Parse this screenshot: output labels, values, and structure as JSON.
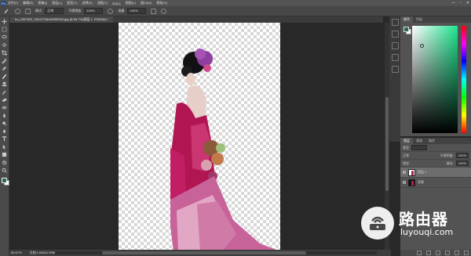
{
  "menubar": {
    "logo": "Ps",
    "items": [
      "文件(F)",
      "编辑(E)",
      "图像(I)",
      "图层(L)",
      "类型(Y)",
      "选择(S)",
      "滤镜(T)",
      "3D(D)",
      "视图(V)",
      "窗口(W)",
      "帮助(H)"
    ],
    "window_controls": [
      "—",
      "▫",
      "✕"
    ]
  },
  "options": {
    "mode_label": "模式:",
    "mode_value": "正常",
    "opacity_label": "不透明度:",
    "opacity_value": "100%",
    "flow_label": "流量:",
    "flow_value": "100%"
  },
  "document": {
    "tab_title": "hu_1557823_26122736c60f0f5062.jpg @ 66.7%(图层 1, RGB/8#) *"
  },
  "status": {
    "zoom": "66.67%",
    "doc_info": "文档:1.65M/1.99M"
  },
  "color_panel": {
    "tabs": [
      "颜色",
      "色板"
    ],
    "fg_color": "#2a6d4c",
    "bg_color": "#ffffff",
    "hue_color": "#1ee58f"
  },
  "layers_panel": {
    "tabs": [
      "图层",
      "通道",
      "路径"
    ],
    "kind_label": "类型",
    "blend_mode": "正常",
    "opacity_label": "不透明度:",
    "opacity_value": "100%",
    "lock_label": "锁定:",
    "fill_label": "填充:",
    "fill_value": "100%",
    "layers": [
      {
        "name": "图层 1",
        "active": true
      },
      {
        "name": "背景",
        "active": false
      }
    ]
  },
  "watermark": {
    "title": "路由器",
    "url": "luyouqi.com"
  }
}
